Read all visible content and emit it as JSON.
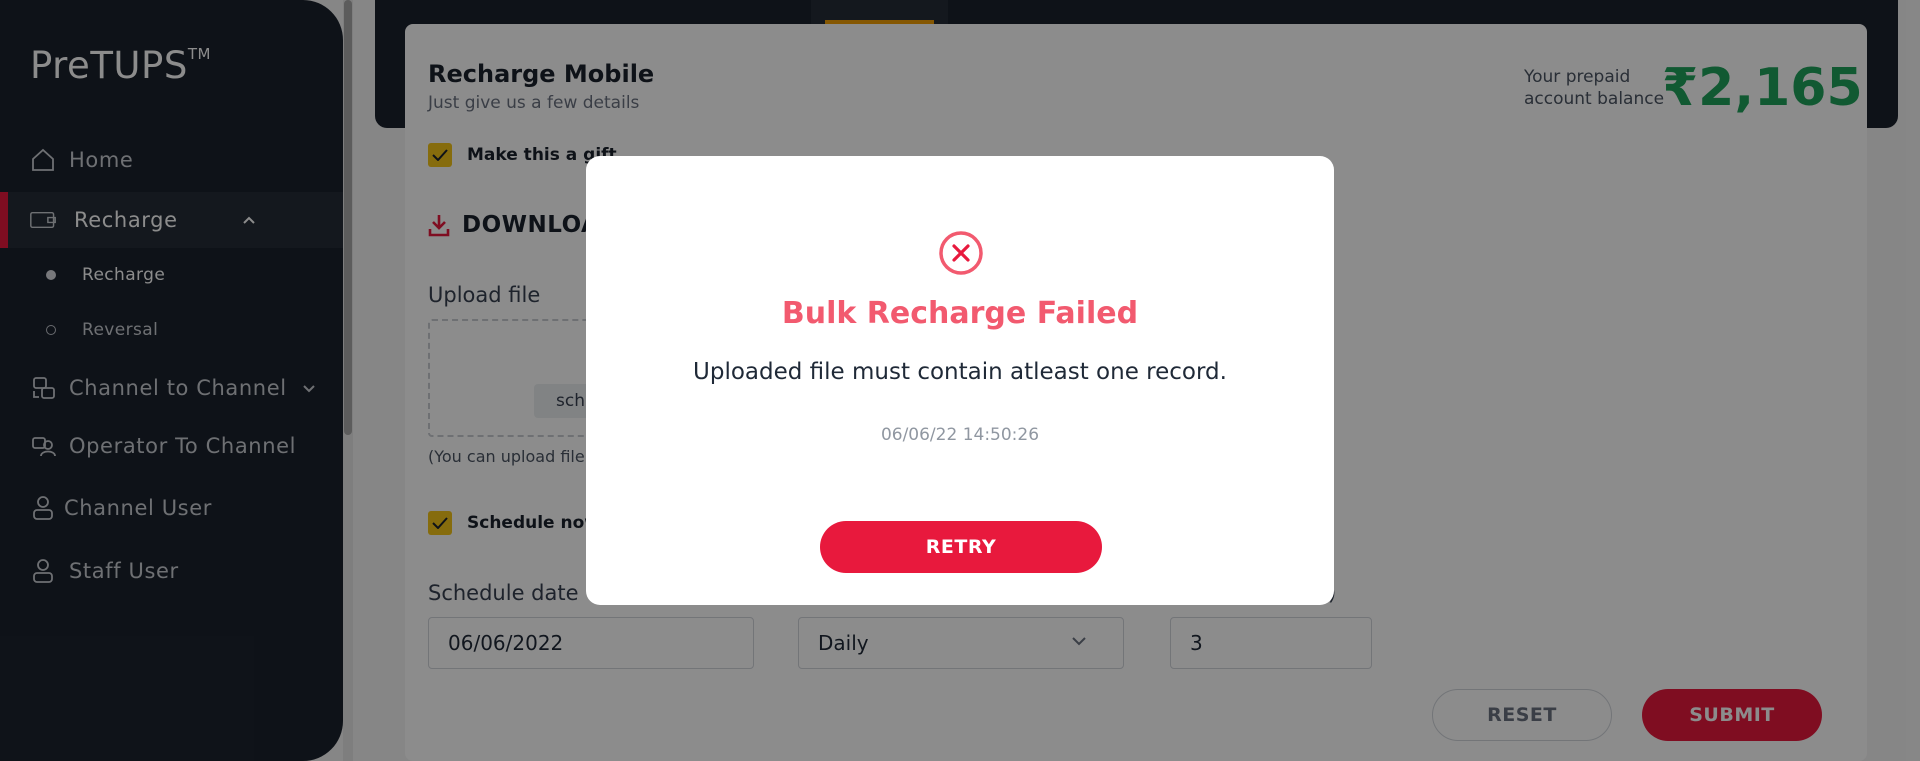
{
  "sidebar": {
    "logo": "PreTUPS",
    "logo_tm": "TM",
    "items": [
      {
        "label": "Home",
        "icon": "home-icon"
      },
      {
        "label": "Recharge",
        "icon": "wallet-icon"
      },
      {
        "label": "Channel to Channel",
        "icon": "channel-icon"
      },
      {
        "label": "Operator To Channel",
        "icon": "operator-icon"
      },
      {
        "label": "Channel User",
        "icon": "user-icon"
      },
      {
        "label": "Staff User",
        "icon": "user-icon"
      }
    ],
    "sub_items": [
      {
        "label": "Recharge"
      },
      {
        "label": "Reversal"
      }
    ]
  },
  "page": {
    "title": "Recharge Mobile",
    "subtitle": "Just give us a few details",
    "balance_label": "Your prepaid account balance",
    "balance_value": "₹2,165",
    "gift_label": "Make this a gift",
    "download_label": "DOWNLOA",
    "upload_label": "Upload file",
    "upload_button_fragment": "sch",
    "upload_hint": "(You can upload file",
    "schedule_now_label": "Schedule now",
    "schedule_date_label": "Schedule date",
    "schedule_date_value": "06/06/2022",
    "frequency_value": "Daily",
    "count_value": "3",
    "paren_fragment": ")",
    "reset_label": "RESET",
    "submit_label": "SUBMIT"
  },
  "modal": {
    "title": "Bulk Recharge Failed",
    "message": "Uploaded file must contain atleast one record.",
    "timestamp": "06/06/22 14:50:26",
    "retry_label": "RETRY"
  },
  "colors": {
    "sidebar_bg": "#1b222d",
    "accent_red": "#e8193d",
    "error_title": "#f25a6f",
    "balance_green": "#1fa25b",
    "checkbox_yellow": "#f5c518"
  }
}
